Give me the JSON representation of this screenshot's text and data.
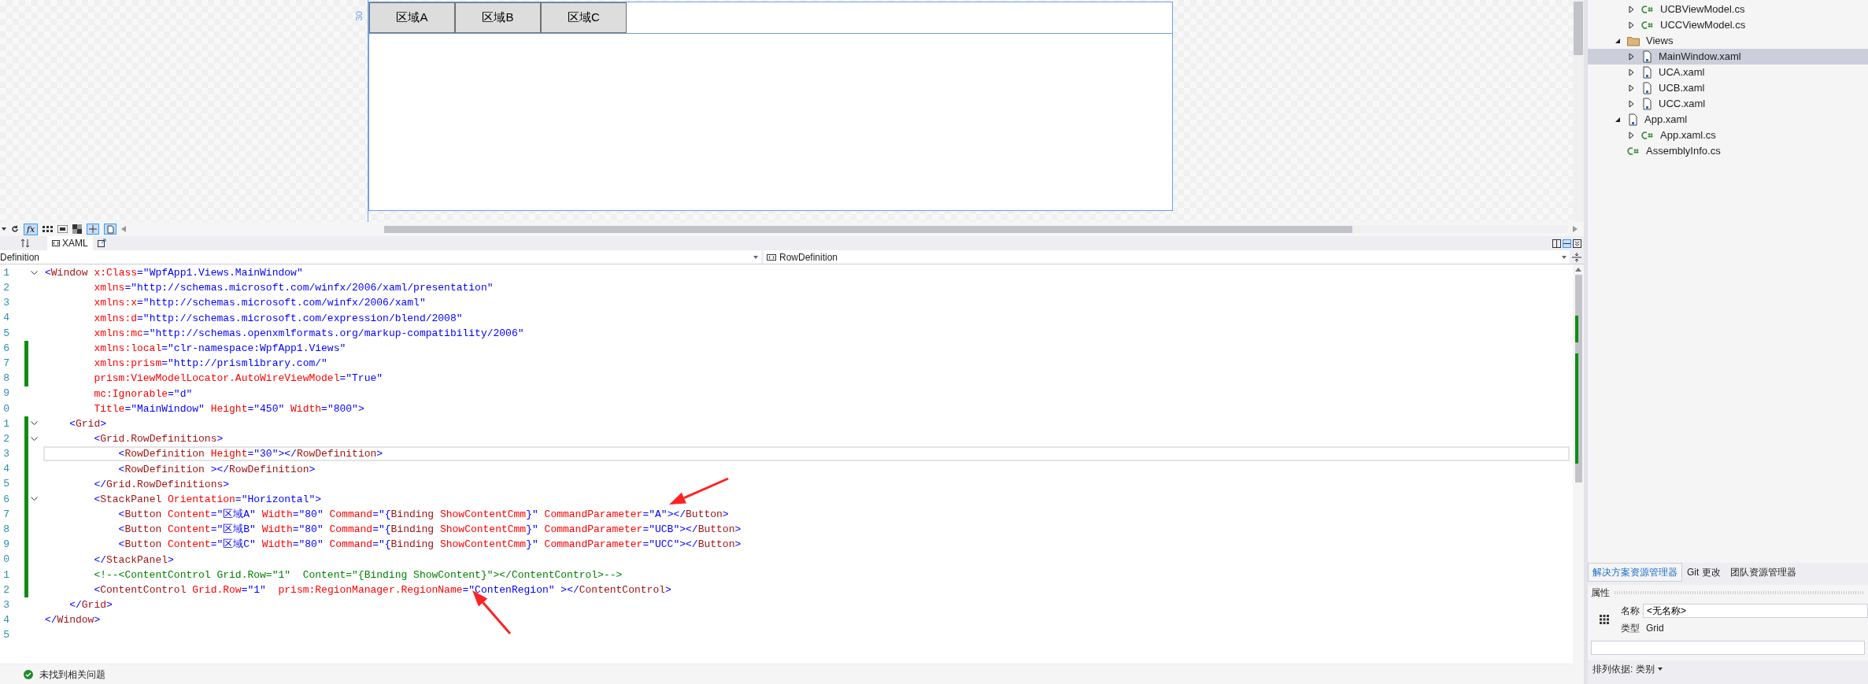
{
  "designer": {
    "ruler_label": "30",
    "buttons": [
      "区域A",
      "区域B",
      "区域C"
    ]
  },
  "toolbar": {
    "formula_label": "fx"
  },
  "editor_tabs": [
    {
      "label": "XAML",
      "selected": true
    }
  ],
  "nav": {
    "left": "Definition",
    "right": "RowDefinition"
  },
  "code": {
    "lines": [
      {
        "number": "1",
        "fold": true,
        "changed": false,
        "current": false,
        "tokens": [
          {
            "kind": "punct",
            "text": "<"
          },
          {
            "kind": "tag",
            "text": "Window"
          },
          {
            "kind": "attr",
            "text": " x:Class"
          },
          {
            "kind": "value",
            "text": "=\"WpfApp1.Views.MainWindow\""
          }
        ]
      },
      {
        "number": "2",
        "fold": false,
        "changed": false,
        "current": false,
        "tokens": [
          {
            "kind": "attr",
            "text": "        xmlns"
          },
          {
            "kind": "value",
            "text": "=\"http://schemas.microsoft.com/winfx/2006/xaml/presentation\""
          }
        ]
      },
      {
        "number": "3",
        "fold": false,
        "changed": false,
        "current": false,
        "tokens": [
          {
            "kind": "attr",
            "text": "        xmlns:x"
          },
          {
            "kind": "value",
            "text": "=\"http://schemas.microsoft.com/winfx/2006/xaml\""
          }
        ]
      },
      {
        "number": "4",
        "fold": false,
        "changed": false,
        "current": false,
        "tokens": [
          {
            "kind": "attr",
            "text": "        xmlns:d"
          },
          {
            "kind": "value",
            "text": "=\"http://schemas.microsoft.com/expression/blend/2008\""
          }
        ]
      },
      {
        "number": "5",
        "fold": false,
        "changed": false,
        "current": false,
        "tokens": [
          {
            "kind": "attr",
            "text": "        xmlns:mc"
          },
          {
            "kind": "value",
            "text": "=\"http://schemas.openxmlformats.org/markup-compatibility/2006\""
          }
        ]
      },
      {
        "number": "6",
        "fold": false,
        "changed": true,
        "current": false,
        "tokens": [
          {
            "kind": "attr",
            "text": "        xmlns:local"
          },
          {
            "kind": "value",
            "text": "=\"clr-namespace:WpfApp1.Views\""
          }
        ]
      },
      {
        "number": "7",
        "fold": false,
        "changed": true,
        "current": false,
        "tokens": [
          {
            "kind": "attr",
            "text": "        xmlns:prism"
          },
          {
            "kind": "value",
            "text": "=\"http://prismlibrary.com/\""
          }
        ]
      },
      {
        "number": "8",
        "fold": false,
        "changed": true,
        "current": false,
        "tokens": [
          {
            "kind": "attr",
            "text": "        prism:ViewModelLocator.AutoWireViewModel"
          },
          {
            "kind": "value",
            "text": "=\"True\""
          }
        ]
      },
      {
        "number": "9",
        "fold": false,
        "changed": false,
        "current": false,
        "tokens": [
          {
            "kind": "attr",
            "text": "        mc:Ignorable"
          },
          {
            "kind": "value",
            "text": "=\"d\""
          }
        ]
      },
      {
        "number": "0",
        "fold": false,
        "changed": false,
        "current": false,
        "tokens": [
          {
            "kind": "attr",
            "text": "        Title"
          },
          {
            "kind": "value",
            "text": "=\"MainWindow\""
          },
          {
            "kind": "attr",
            "text": " Height"
          },
          {
            "kind": "value",
            "text": "=\"450\""
          },
          {
            "kind": "attr",
            "text": " Width"
          },
          {
            "kind": "value",
            "text": "=\"800\""
          },
          {
            "kind": "punct",
            "text": ">"
          }
        ]
      },
      {
        "number": "1",
        "fold": true,
        "changed": true,
        "current": false,
        "tokens": [
          {
            "kind": "punct",
            "text": "    <"
          },
          {
            "kind": "tag",
            "text": "Grid"
          },
          {
            "kind": "punct",
            "text": ">"
          }
        ]
      },
      {
        "number": "2",
        "fold": true,
        "changed": true,
        "current": false,
        "tokens": [
          {
            "kind": "punct",
            "text": "        <"
          },
          {
            "kind": "tag",
            "text": "Grid.RowDefinitions"
          },
          {
            "kind": "punct",
            "text": ">"
          }
        ]
      },
      {
        "number": "3",
        "fold": false,
        "changed": true,
        "current": true,
        "tokens": [
          {
            "kind": "punct",
            "text": "            <"
          },
          {
            "kind": "tag",
            "text": "RowDefinition"
          },
          {
            "kind": "attr",
            "text": " Height"
          },
          {
            "kind": "value",
            "text": "=\"30\""
          },
          {
            "kind": "punct",
            "text": "></"
          },
          {
            "kind": "tag",
            "text": "RowDefinition"
          },
          {
            "kind": "punct",
            "text": ">"
          }
        ]
      },
      {
        "number": "4",
        "fold": false,
        "changed": true,
        "current": false,
        "tokens": [
          {
            "kind": "punct",
            "text": "            <"
          },
          {
            "kind": "tag",
            "text": "RowDefinition"
          },
          {
            "kind": "punct",
            "text": " ></"
          },
          {
            "kind": "tag",
            "text": "RowDefinition"
          },
          {
            "kind": "punct",
            "text": ">"
          }
        ]
      },
      {
        "number": "5",
        "fold": false,
        "changed": true,
        "current": false,
        "tokens": [
          {
            "kind": "punct",
            "text": "        </"
          },
          {
            "kind": "tag",
            "text": "Grid.RowDefinitions"
          },
          {
            "kind": "punct",
            "text": ">"
          }
        ]
      },
      {
        "number": "6",
        "fold": true,
        "changed": true,
        "current": false,
        "tokens": [
          {
            "kind": "punct",
            "text": "        <"
          },
          {
            "kind": "tag",
            "text": "StackPanel"
          },
          {
            "kind": "attr",
            "text": " Orientation"
          },
          {
            "kind": "value",
            "text": "=\"Horizontal\""
          },
          {
            "kind": "punct",
            "text": ">"
          }
        ]
      },
      {
        "number": "7",
        "fold": false,
        "changed": true,
        "current": false,
        "tokens": [
          {
            "kind": "punct",
            "text": "            <"
          },
          {
            "kind": "tag",
            "text": "Button"
          },
          {
            "kind": "attr",
            "text": " Content"
          },
          {
            "kind": "value",
            "text": "=\"区域A\""
          },
          {
            "kind": "attr",
            "text": " Width"
          },
          {
            "kind": "value",
            "text": "=\"80\""
          },
          {
            "kind": "attr",
            "text": " Command"
          },
          {
            "kind": "value",
            "text": "=\"{"
          },
          {
            "kind": "tag",
            "text": "Binding"
          },
          {
            "kind": "attr",
            "text": " ShowContentCmm"
          },
          {
            "kind": "value",
            "text": "}\""
          },
          {
            "kind": "attr",
            "text": " CommandParameter"
          },
          {
            "kind": "value",
            "text": "=\"A\""
          },
          {
            "kind": "punct",
            "text": "></"
          },
          {
            "kind": "tag",
            "text": "Button"
          },
          {
            "kind": "punct",
            "text": ">"
          }
        ]
      },
      {
        "number": "8",
        "fold": false,
        "changed": true,
        "current": false,
        "tokens": [
          {
            "kind": "punct",
            "text": "            <"
          },
          {
            "kind": "tag",
            "text": "Button"
          },
          {
            "kind": "attr",
            "text": " Content"
          },
          {
            "kind": "value",
            "text": "=\"区域B\""
          },
          {
            "kind": "attr",
            "text": " Width"
          },
          {
            "kind": "value",
            "text": "=\"80\""
          },
          {
            "kind": "attr",
            "text": " Command"
          },
          {
            "kind": "value",
            "text": "=\"{"
          },
          {
            "kind": "tag",
            "text": "Binding"
          },
          {
            "kind": "attr",
            "text": " ShowContentCmm"
          },
          {
            "kind": "value",
            "text": "}\""
          },
          {
            "kind": "attr",
            "text": " CommandParameter"
          },
          {
            "kind": "value",
            "text": "=\"UCB\""
          },
          {
            "kind": "punct",
            "text": "></"
          },
          {
            "kind": "tag",
            "text": "Button"
          },
          {
            "kind": "punct",
            "text": ">"
          }
        ]
      },
      {
        "number": "9",
        "fold": false,
        "changed": true,
        "current": false,
        "tokens": [
          {
            "kind": "punct",
            "text": "            <"
          },
          {
            "kind": "tag",
            "text": "Button"
          },
          {
            "kind": "attr",
            "text": " Content"
          },
          {
            "kind": "value",
            "text": "=\"区域C\""
          },
          {
            "kind": "attr",
            "text": " Width"
          },
          {
            "kind": "value",
            "text": "=\"80\""
          },
          {
            "kind": "attr",
            "text": " Command"
          },
          {
            "kind": "value",
            "text": "=\"{"
          },
          {
            "kind": "tag",
            "text": "Binding"
          },
          {
            "kind": "attr",
            "text": " ShowContentCmm"
          },
          {
            "kind": "value",
            "text": "}\""
          },
          {
            "kind": "attr",
            "text": " CommandParameter"
          },
          {
            "kind": "value",
            "text": "=\"UCC\""
          },
          {
            "kind": "punct",
            "text": "></"
          },
          {
            "kind": "tag",
            "text": "Button"
          },
          {
            "kind": "punct",
            "text": ">"
          }
        ]
      },
      {
        "number": "0",
        "fold": false,
        "changed": true,
        "current": false,
        "tokens": [
          {
            "kind": "punct",
            "text": "        </"
          },
          {
            "kind": "tag",
            "text": "StackPanel"
          },
          {
            "kind": "punct",
            "text": ">"
          }
        ]
      },
      {
        "number": "1",
        "fold": false,
        "changed": true,
        "current": false,
        "tokens": [
          {
            "kind": "comment",
            "text": "        <!--<ContentControl Grid.Row=\"1\"  Content=\"{Binding ShowContent}\"></ContentControl>-->"
          }
        ]
      },
      {
        "number": "2",
        "fold": false,
        "changed": true,
        "current": false,
        "tokens": [
          {
            "kind": "punct",
            "text": "        <"
          },
          {
            "kind": "tag",
            "text": "ContentControl"
          },
          {
            "kind": "attr",
            "text": " Grid.Row"
          },
          {
            "kind": "value",
            "text": "=\"1\""
          },
          {
            "kind": "attr",
            "text": "  prism:RegionManager.RegionName"
          },
          {
            "kind": "value",
            "text": "=\"ContenRegion\""
          },
          {
            "kind": "punct",
            "text": " ></"
          },
          {
            "kind": "tag",
            "text": "ContentControl"
          },
          {
            "kind": "punct",
            "text": ">"
          }
        ]
      },
      {
        "number": "3",
        "fold": false,
        "changed": false,
        "current": false,
        "tokens": [
          {
            "kind": "punct",
            "text": "    </"
          },
          {
            "kind": "tag",
            "text": "Grid"
          },
          {
            "kind": "punct",
            "text": ">"
          }
        ]
      },
      {
        "number": "4",
        "fold": false,
        "changed": false,
        "current": false,
        "tokens": [
          {
            "kind": "punct",
            "text": "</"
          },
          {
            "kind": "tag",
            "text": "Window"
          },
          {
            "kind": "punct",
            "text": ">"
          }
        ]
      },
      {
        "number": "5",
        "fold": false,
        "changed": false,
        "current": false
      }
    ]
  },
  "status_bar": {
    "message": "未找到相关问题"
  },
  "solution_explorer": {
    "continued": [
      {
        "label": "UCBViewModel.cs",
        "kind": "csharp",
        "expandable": true,
        "expanded": false,
        "selected": false
      },
      {
        "label": "UCCViewModel.cs",
        "kind": "csharp",
        "expandable": true,
        "expanded": false,
        "selected": false
      }
    ],
    "items": [
      {
        "label": "Views",
        "kind": "folder",
        "expandable": true,
        "expanded": true,
        "selected": false,
        "children": [
          {
            "label": "MainWindow.xaml",
            "kind": "xaml",
            "expandable": true,
            "expanded": false,
            "selected": true
          },
          {
            "label": "UCA.xaml",
            "kind": "xaml",
            "expandable": true,
            "expanded": false,
            "selected": false
          },
          {
            "label": "UCB.xaml",
            "kind": "xaml",
            "expandable": true,
            "expanded": false,
            "selected": false
          },
          {
            "label": "UCC.xaml",
            "kind": "xaml",
            "expandable": true,
            "expanded": false,
            "selected": false
          }
        ]
      },
      {
        "label": "App.xaml",
        "kind": "xaml",
        "expandable": true,
        "expanded": true,
        "selected": false,
        "children": [
          {
            "label": "App.xaml.cs",
            "kind": "csharp",
            "expandable": true,
            "expanded": false,
            "selected": false
          }
        ]
      },
      {
        "label": "AssemblyInfo.cs",
        "kind": "csharp",
        "expandable": false,
        "selected": false
      }
    ]
  },
  "panel_tabs": [
    {
      "label": "解决方案资源管理器",
      "selected": true
    },
    {
      "label": "Git 更改",
      "selected": false
    },
    {
      "label": "团队资源管理器",
      "selected": false
    }
  ],
  "properties": {
    "title": "属性",
    "name_label": "名称",
    "name_value": "<无名称>",
    "type_label": "类型",
    "type_value": "Grid",
    "sort_label": "排列依据: 类别"
  }
}
